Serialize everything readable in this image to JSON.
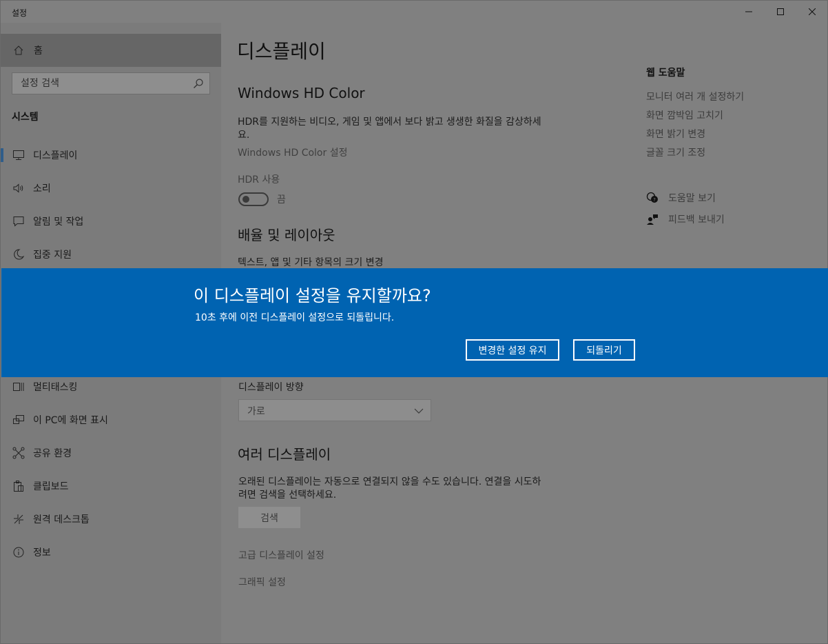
{
  "window": {
    "title": "설정"
  },
  "sidebar": {
    "home_label": "홈",
    "search_placeholder": "설정 검색",
    "section_title": "시스템",
    "items": [
      {
        "label": "디스플레이",
        "icon": "monitor-icon"
      },
      {
        "label": "소리",
        "icon": "speaker-icon"
      },
      {
        "label": "알림 및 작업",
        "icon": "notification-icon"
      },
      {
        "label": "집중 지원",
        "icon": "moon-icon"
      },
      {
        "label": "멀티태스킹",
        "icon": "multitask-icon"
      },
      {
        "label": "이 PC에 화면 표시",
        "icon": "project-icon"
      },
      {
        "label": "공유 환경",
        "icon": "share-icon"
      },
      {
        "label": "클립보드",
        "icon": "clipboard-icon"
      },
      {
        "label": "원격 데스크톱",
        "icon": "remote-icon"
      },
      {
        "label": "정보",
        "icon": "info-icon"
      }
    ]
  },
  "main": {
    "title": "디스플레이",
    "hd_color": {
      "heading": "Windows HD Color",
      "description": "HDR를 지원하는 비디오, 게임 및 앱에서 보다 밝고 생생한 화질을 감상하세요.",
      "settings_link": "Windows HD Color 설정",
      "hdr_label": "HDR 사용",
      "hdr_state": "끔"
    },
    "scale": {
      "heading": "배율 및 레이아웃",
      "text_size_label": "텍스트, 앱 및 기타 항목의 크기 변경"
    },
    "orientation": {
      "label": "디스플레이 방향",
      "value": "가로"
    },
    "multi": {
      "heading": "여러 디스플레이",
      "description": "오래된 디스플레이는 자동으로 연결되지 않을 수도 있습니다. 연결을 시도하려면 검색을 선택하세요.",
      "detect_button": "검색",
      "advanced_link": "고급 디스플레이 설정",
      "graphics_link": "그래픽 설정"
    }
  },
  "help": {
    "heading": "웹 도움말",
    "links": [
      "모니터 여러 개 설정하기",
      "화면 깜박임 고치기",
      "화면 밝기 변경",
      "글꼴 크기 조정"
    ],
    "get_help": "도움말 보기",
    "feedback": "피드백 보내기"
  },
  "banner": {
    "question": "이 디스플레이 설정을 유지할까요?",
    "subtitle": "10초 후에 이전 디스플레이 설정으로 되돌립니다.",
    "keep_button": "변경한 설정 유지",
    "revert_button": "되돌리기",
    "color": "#0063b1"
  }
}
